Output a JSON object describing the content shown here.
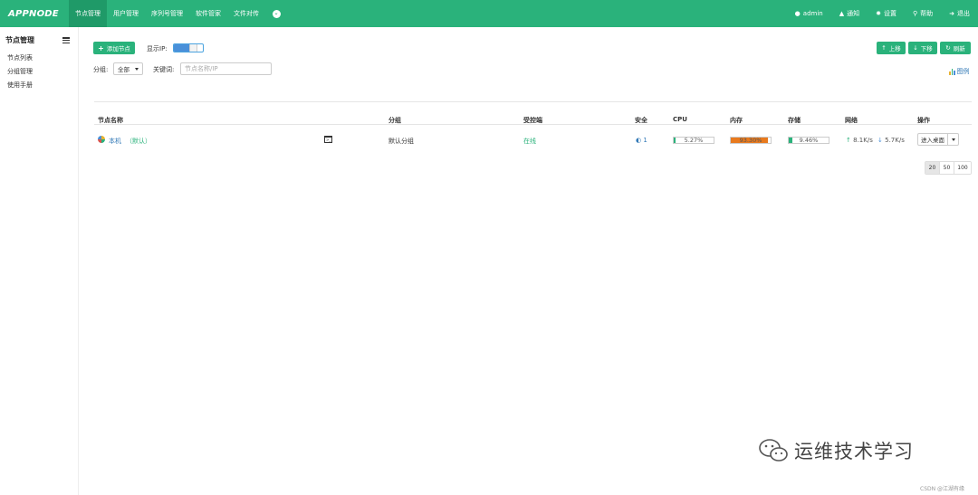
{
  "brand": "APPNODE",
  "nav": {
    "items": [
      {
        "label": "节点管理",
        "active": true
      },
      {
        "label": "用户管理",
        "active": false
      },
      {
        "label": "序列号管理",
        "active": false
      },
      {
        "label": "软件管家",
        "active": false
      },
      {
        "label": "文件对传",
        "active": false
      }
    ],
    "more_icon": "chevron-circle-down-icon"
  },
  "top_right": {
    "user": "admin",
    "notify": "通知",
    "settings": "设置",
    "help": "帮助",
    "logout": "退出"
  },
  "sidebar": {
    "title": "节点管理",
    "items": [
      {
        "label": "节点列表"
      },
      {
        "label": "分组管理"
      },
      {
        "label": "使用手册"
      }
    ]
  },
  "toolbar": {
    "add_node": "添加节点",
    "show_ip_label": "显示IP:",
    "show_ip_on": true,
    "group_label": "分组:",
    "group_value": "全部",
    "keyword_label": "关键词:",
    "keyword_placeholder": "节点名称/IP",
    "move_up": "上移",
    "move_down": "下移",
    "refresh": "刷新",
    "legend": "图例"
  },
  "table": {
    "headers": {
      "name": "节点名称",
      "group": "分组",
      "controlled": "受控端",
      "security": "安全",
      "cpu": "CPU",
      "memory": "内存",
      "storage": "存储",
      "network": "网络",
      "actions": "操作"
    },
    "rows": [
      {
        "name": "本机",
        "tag": "（默认）",
        "group": "默认分组",
        "status": "在线",
        "security": "1",
        "cpu": "5.27%",
        "cpu_pct": 5.27,
        "memory": "93.30%",
        "memory_pct": 93.3,
        "storage": "9.46%",
        "storage_pct": 9.46,
        "net_up": "8.1K/s",
        "net_down": "5.7K/s",
        "enter_desktop": "进入桌面"
      }
    ]
  },
  "pagination": [
    "20",
    "50",
    "100"
  ],
  "pagination_active": "20",
  "watermark": "运维技术学习",
  "credit": "CSDN @江湖有缘",
  "colors": {
    "primary": "#2ab27b",
    "primary_dark": "#1f9a68",
    "memory_bar": "#e87a1e",
    "link": "#337ab7"
  }
}
